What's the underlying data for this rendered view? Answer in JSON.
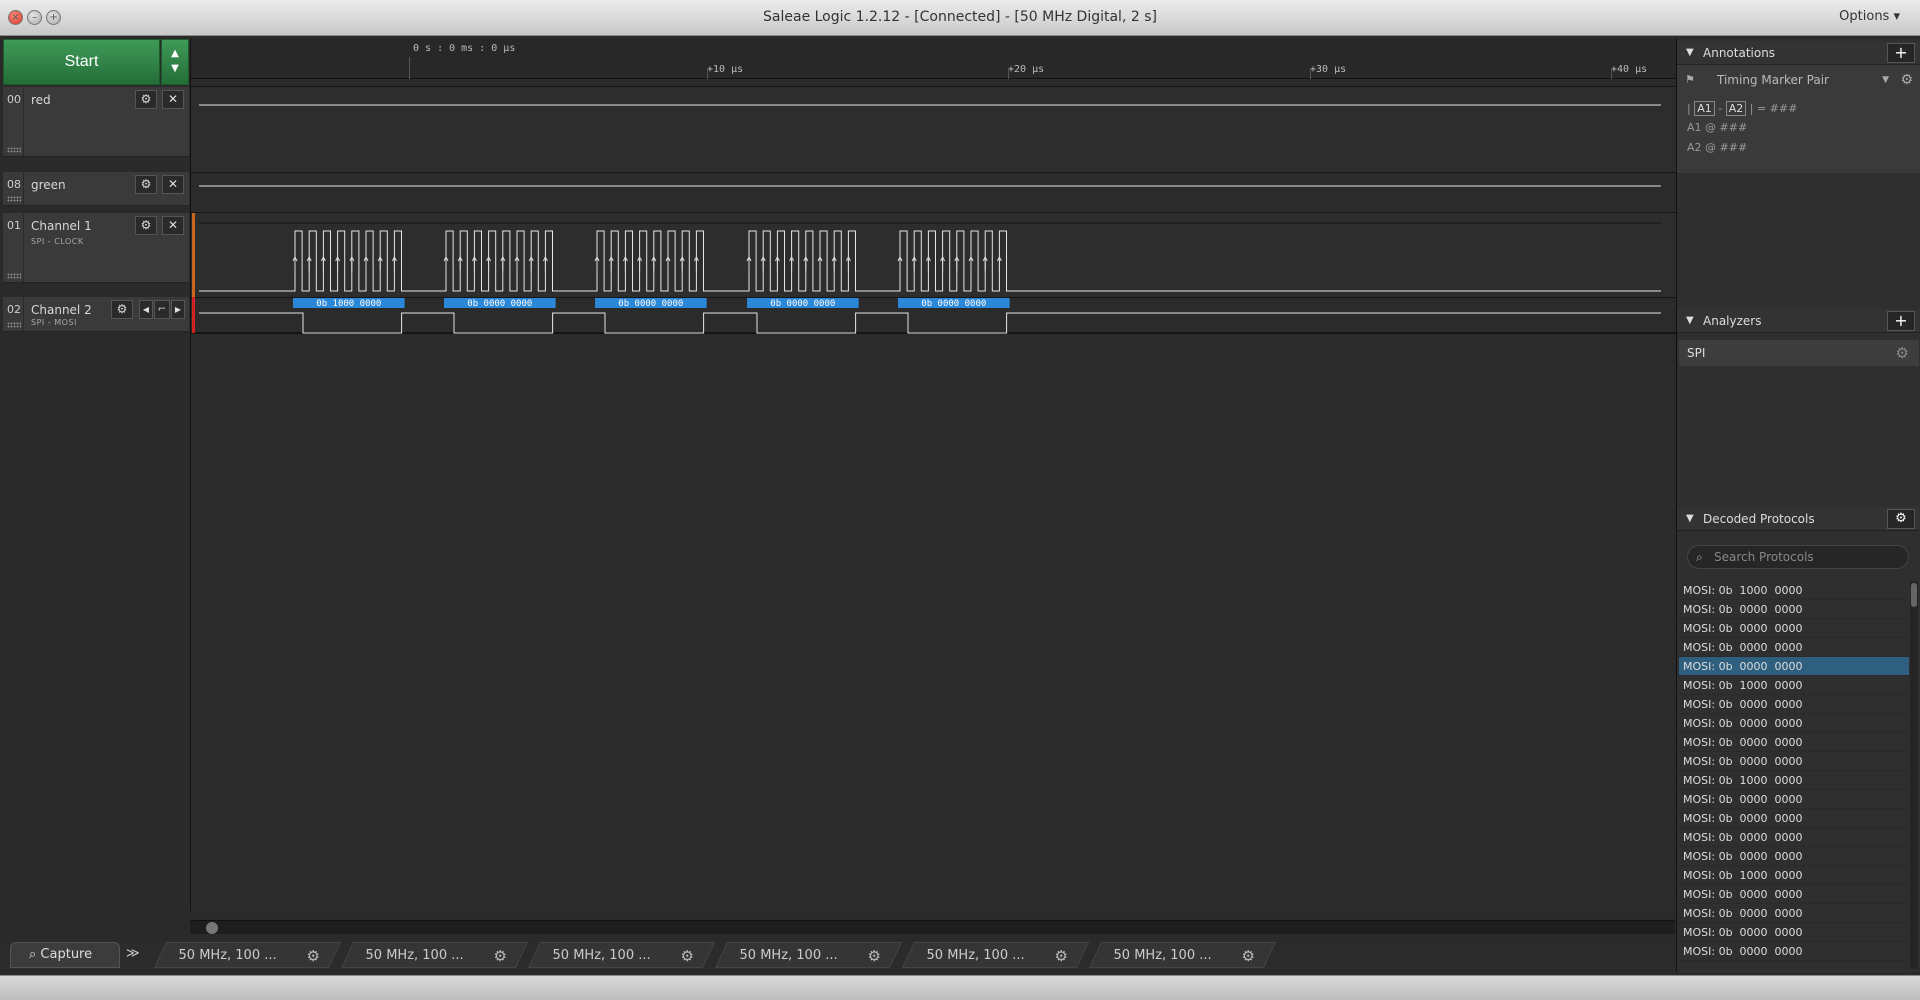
{
  "window": {
    "title": "Saleae Logic 1.2.12 - [Connected] - [50 MHz Digital, 2 s]",
    "options_label": "Options ▾"
  },
  "controls": {
    "start_label": "Start"
  },
  "ruler": {
    "origin_label": "0 s : 0 ms : 0 µs",
    "ticks": [
      "+10 µs",
      "+20 µs",
      "+30 µs",
      "+40 µs"
    ]
  },
  "channels": [
    {
      "number": "00",
      "name": "red",
      "subtitle": ""
    },
    {
      "number": "08",
      "name": "green",
      "subtitle": ""
    },
    {
      "number": "01",
      "name": "Channel 1",
      "subtitle": "SPI - CLOCK"
    },
    {
      "number": "02",
      "name": "Channel 2",
      "subtitle": "SPI - MOSI"
    }
  ],
  "decoded_bytes": [
    "0b 1000 0000",
    "0b 0000 0000",
    "0b 0000 0000",
    "0b 0000 0000",
    "0b 0000 0000"
  ],
  "mosi_levels": [
    [
      0,
      0,
      0,
      0,
      0,
      0,
      0,
      0
    ],
    [
      0,
      0,
      0,
      0,
      0,
      0,
      0,
      0
    ]
  ],
  "bottom_tabs": {
    "capture_label": "Capture",
    "sessions": [
      "50 MHz, 100 ...",
      "50 MHz, 100 ...",
      "50 MHz, 100 ...",
      "50 MHz, 100 ...",
      "50 MHz, 100 ...",
      "50 MHz, 100 ..."
    ]
  },
  "annotations": {
    "header": "Annotations",
    "marker_type": "Timing Marker Pair",
    "pair_line": {
      "a1": "A1",
      "a2": "A2",
      "value": "= ###"
    },
    "a1_line": "A1  @  ###",
    "a2_line": "A2  @  ###"
  },
  "analyzers": {
    "header": "Analyzers",
    "items": [
      "SPI"
    ]
  },
  "decoded_protocols": {
    "header": "Decoded Protocols",
    "search_placeholder": "Search Protocols",
    "selected_index": 4,
    "items": [
      "MOSI: 0b  1000  0000",
      "MOSI: 0b  0000  0000",
      "MOSI: 0b  0000  0000",
      "MOSI: 0b  0000  0000",
      "MOSI: 0b  0000  0000",
      "MOSI: 0b  1000  0000",
      "MOSI: 0b  0000  0000",
      "MOSI: 0b  0000  0000",
      "MOSI: 0b  0000  0000",
      "MOSI: 0b  0000  0000",
      "MOSI: 0b  1000  0000",
      "MOSI: 0b  0000  0000",
      "MOSI: 0b  0000  0000",
      "MOSI: 0b  0000  0000",
      "MOSI: 0b  0000  0000",
      "MOSI: 0b  1000  0000",
      "MOSI: 0b  0000  0000",
      "MOSI: 0b  0000  0000",
      "MOSI: 0b  0000  0000",
      "MOSI: 0b  0000  0000"
    ]
  },
  "colors": {
    "accent_green": "#2f8a48",
    "decode_blue": "#2b88d8",
    "selected_row": "#2f5f7f",
    "trigger_orange": "#c8671e",
    "trigger_red": "#d22222"
  }
}
